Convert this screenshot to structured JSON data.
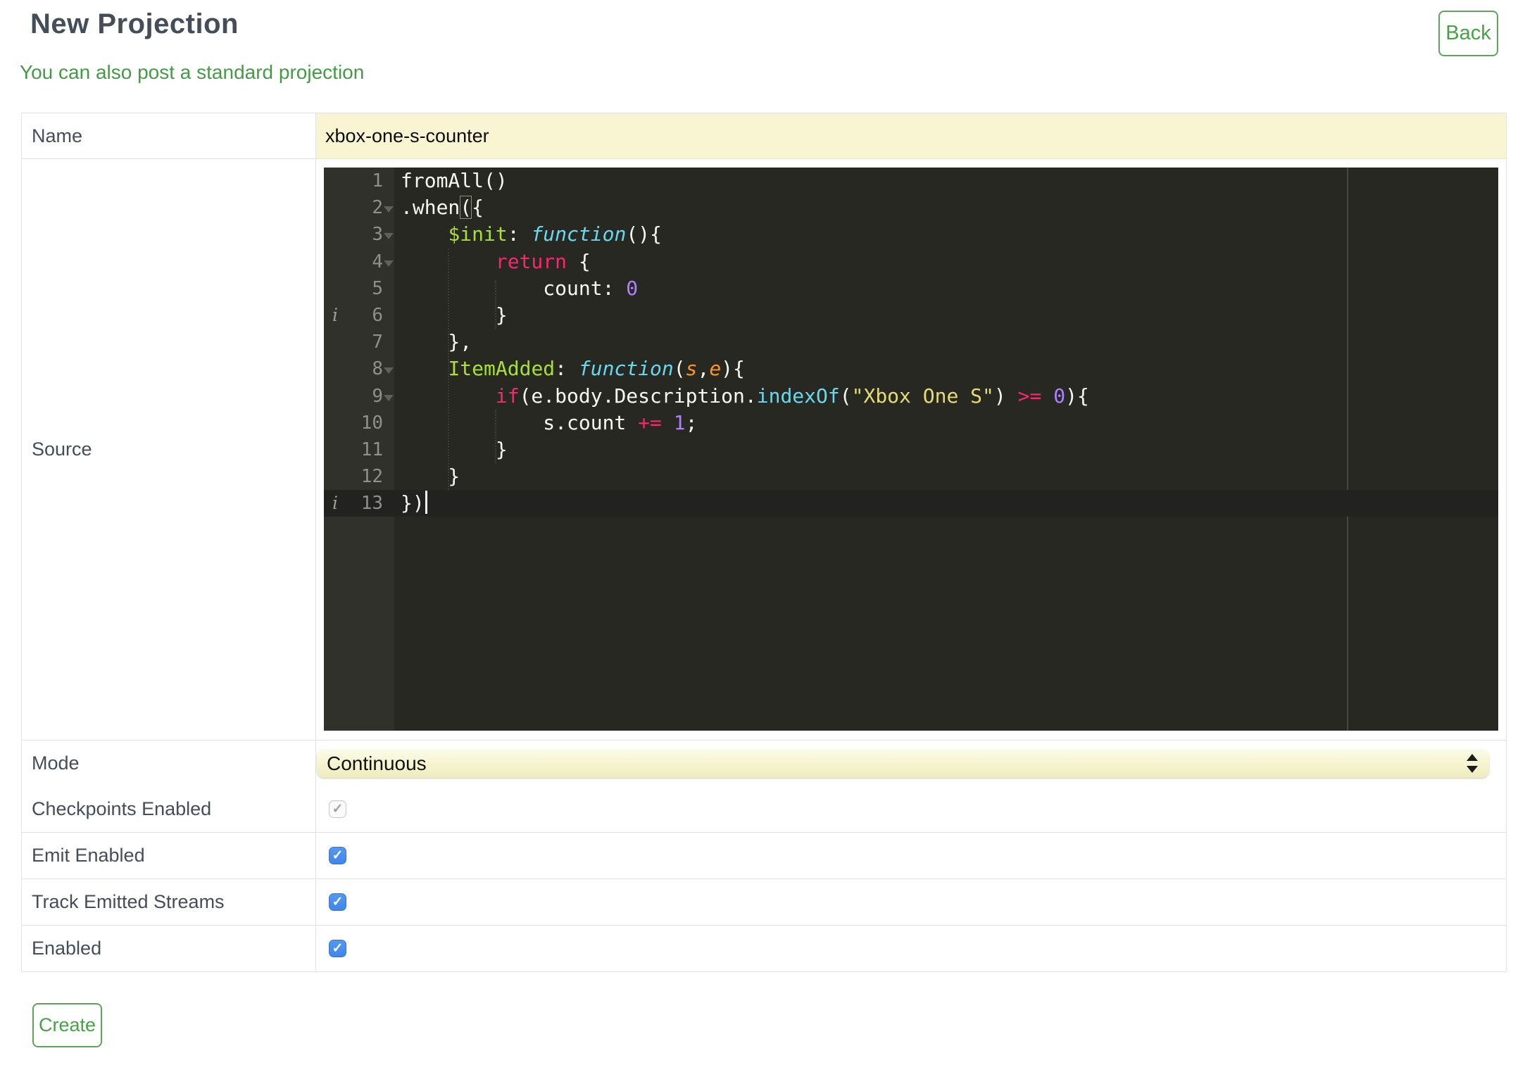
{
  "header": {
    "title": "New Projection",
    "back_label": "Back",
    "standard_projection_link": "You can also post a standard projection"
  },
  "form": {
    "name": {
      "label": "Name",
      "value": "xbox-one-s-counter"
    },
    "source": {
      "label": "Source"
    },
    "mode": {
      "label": "Mode",
      "value": "Continuous"
    },
    "checkboxes": [
      {
        "label": "Checkpoints Enabled",
        "checked": true,
        "enabled": false
      },
      {
        "label": "Emit Enabled",
        "checked": true,
        "enabled": true
      },
      {
        "label": "Track Emitted Streams",
        "checked": true,
        "enabled": true
      },
      {
        "label": "Enabled",
        "checked": true,
        "enabled": true
      }
    ],
    "create_label": "Create"
  },
  "editor": {
    "language": "javascript",
    "active_line": 13,
    "annotation_lines": [
      6,
      13
    ],
    "fold_lines": [
      2,
      3,
      4,
      8,
      9
    ],
    "lines": [
      {
        "n": 1,
        "tokens": [
          [
            "w",
            "fromAll()"
          ]
        ]
      },
      {
        "n": 2,
        "fold": true,
        "tokens": [
          [
            "w",
            ".when"
          ],
          [
            "bm",
            "("
          ],
          [
            "w",
            "{"
          ]
        ]
      },
      {
        "n": 3,
        "fold": true,
        "tokens": [
          [
            "w",
            "    "
          ],
          [
            "g",
            "$init"
          ],
          [
            "w",
            ": "
          ],
          [
            "fi",
            "function"
          ],
          [
            "w",
            "(){"
          ]
        ]
      },
      {
        "n": 4,
        "fold": true,
        "tokens": [
          [
            "w",
            "        "
          ],
          [
            "k",
            "return"
          ],
          [
            "w",
            " {"
          ]
        ]
      },
      {
        "n": 5,
        "tokens": [
          [
            "w",
            "            count: "
          ],
          [
            "nu",
            "0"
          ]
        ]
      },
      {
        "n": 6,
        "ann": true,
        "tokens": [
          [
            "w",
            "        }"
          ]
        ]
      },
      {
        "n": 7,
        "tokens": [
          [
            "w",
            "    },"
          ]
        ]
      },
      {
        "n": 8,
        "fold": true,
        "tokens": [
          [
            "w",
            "    "
          ],
          [
            "g",
            "ItemAdded"
          ],
          [
            "w",
            ": "
          ],
          [
            "fi",
            "function"
          ],
          [
            "w",
            "("
          ],
          [
            "p",
            "s"
          ],
          [
            "w",
            ","
          ],
          [
            "p",
            "e"
          ],
          [
            "w",
            "){"
          ]
        ]
      },
      {
        "n": 9,
        "fold": true,
        "tokens": [
          [
            "w",
            "        "
          ],
          [
            "k",
            "if"
          ],
          [
            "w",
            "(e.body.Description."
          ],
          [
            "su",
            "indexOf"
          ],
          [
            "w",
            "("
          ],
          [
            "st",
            "\"Xbox One S\""
          ],
          [
            "w",
            ") "
          ],
          [
            "k",
            ">="
          ],
          [
            "w",
            " "
          ],
          [
            "nu",
            "0"
          ],
          [
            "w",
            "){"
          ]
        ]
      },
      {
        "n": 10,
        "tokens": [
          [
            "w",
            "            s.count "
          ],
          [
            "k",
            "+="
          ],
          [
            "w",
            " "
          ],
          [
            "nu",
            "1"
          ],
          [
            "w",
            ";"
          ]
        ]
      },
      {
        "n": 11,
        "tokens": [
          [
            "w",
            "        }"
          ]
        ]
      },
      {
        "n": 12,
        "tokens": [
          [
            "w",
            "    }"
          ]
        ]
      },
      {
        "n": 13,
        "ann": true,
        "active": true,
        "cursor": true,
        "tokens": [
          [
            "w",
            "})"
          ]
        ]
      }
    ]
  },
  "icons": {
    "check": "✓",
    "info": "i"
  },
  "colors": {
    "accent_green": "#47A247",
    "title_text": "#434E59",
    "checkbox_blue": "#4A90E9",
    "name_field_bg": "#F9F5D3",
    "select_bg": "#F6F4CF",
    "editor_background": "#272822",
    "editor_gutter": "#2F312A",
    "editor_active_line": "#222221",
    "code_green": "#A6E22E",
    "code_pink": "#F92672",
    "code_cyan": "#66D9EF",
    "code_yellow": "#E6DB74",
    "code_purple": "#AE81FF",
    "code_orange": "#FD971F"
  }
}
